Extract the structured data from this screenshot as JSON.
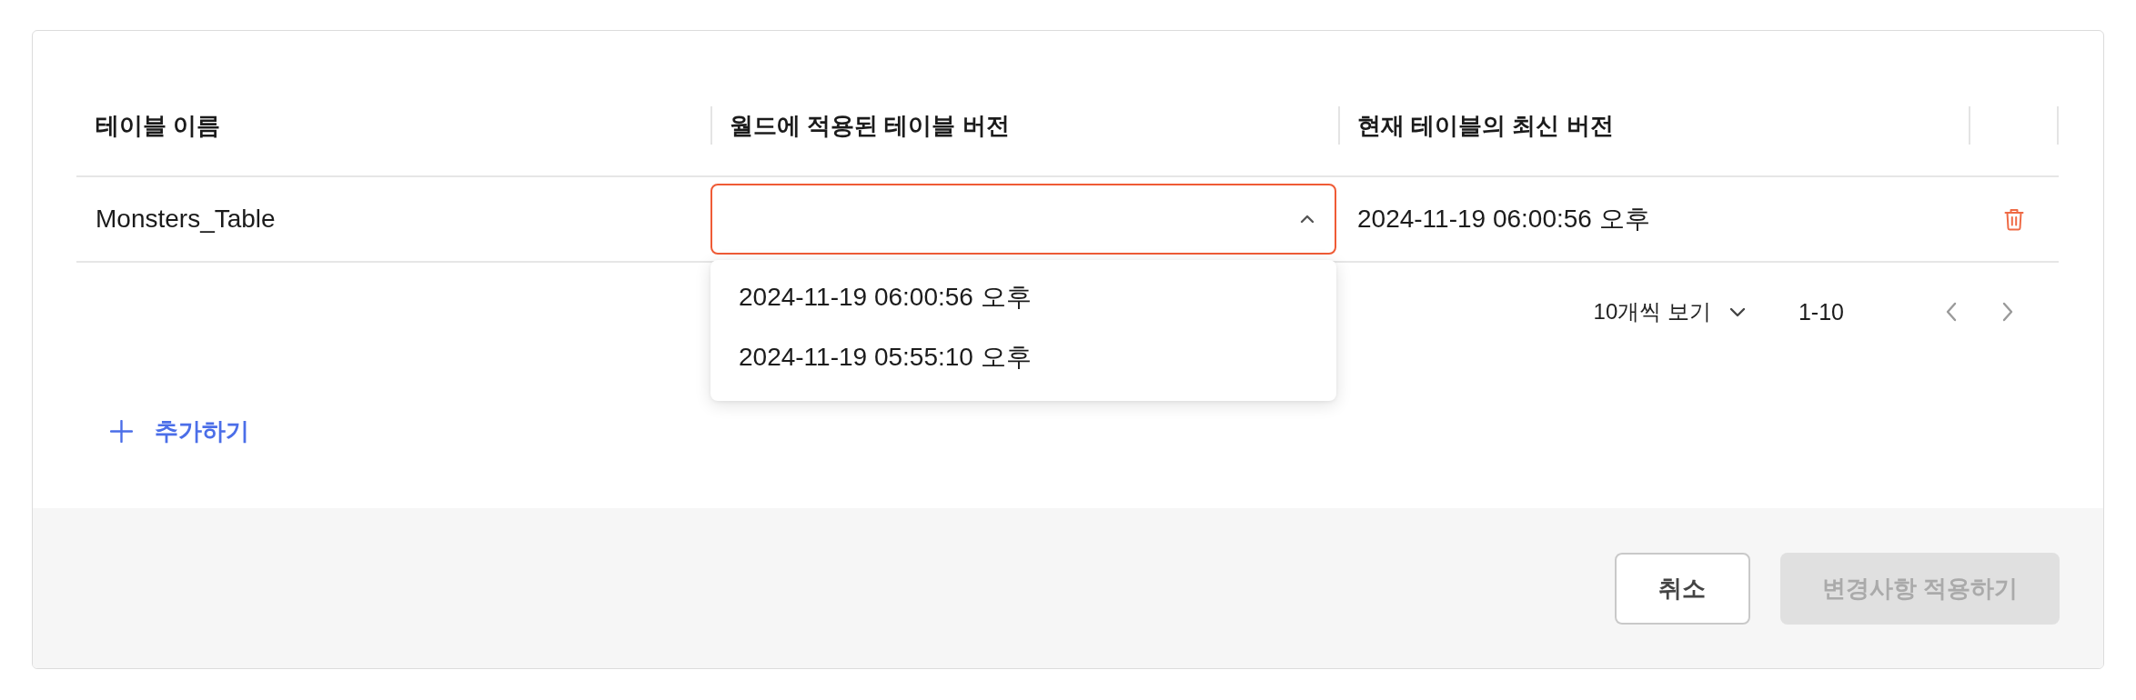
{
  "table": {
    "columns": [
      "테이블 이름",
      "월드에 적용된 테이블 버전",
      "현재 테이블의 최신 버전"
    ],
    "rows": [
      {
        "name": "Monsters_Table",
        "applied_version": {
          "expanded": true,
          "options": [
            {
              "label": "2024-11-19 06:00:56 오후",
              "selected": false
            },
            {
              "label": "2024-11-19 05:55:10 오후",
              "selected": false
            }
          ]
        },
        "latest_version": "2024-11-19 06:00:56 오후"
      }
    ]
  },
  "pagination": {
    "page_size": "10개씩 보기",
    "range": "1-10"
  },
  "add_button": {
    "label": "추가하기"
  },
  "footer": {
    "buttons": [
      {
        "kind": "secondary",
        "label": "취소",
        "disabled": false
      },
      {
        "kind": "primary",
        "label": "변경사항 적용하기",
        "disabled": true
      }
    ]
  }
}
